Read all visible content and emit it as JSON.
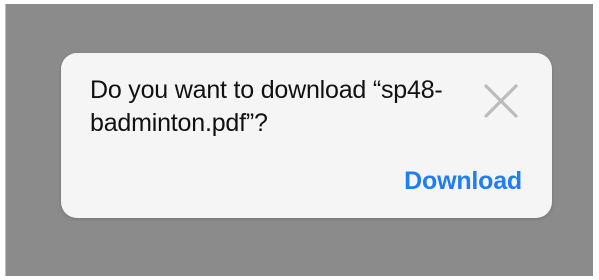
{
  "dialog": {
    "message": "Do you want to download “sp48-badminton.pdf”?",
    "close_icon": "close-icon",
    "download_label": "Download"
  },
  "colors": {
    "backdrop": "#8b8b8b",
    "dialog_background": "#f5f5f5",
    "text": "#111111",
    "accent": "#1f7ef2",
    "close_icon": "#bcbcbc"
  }
}
